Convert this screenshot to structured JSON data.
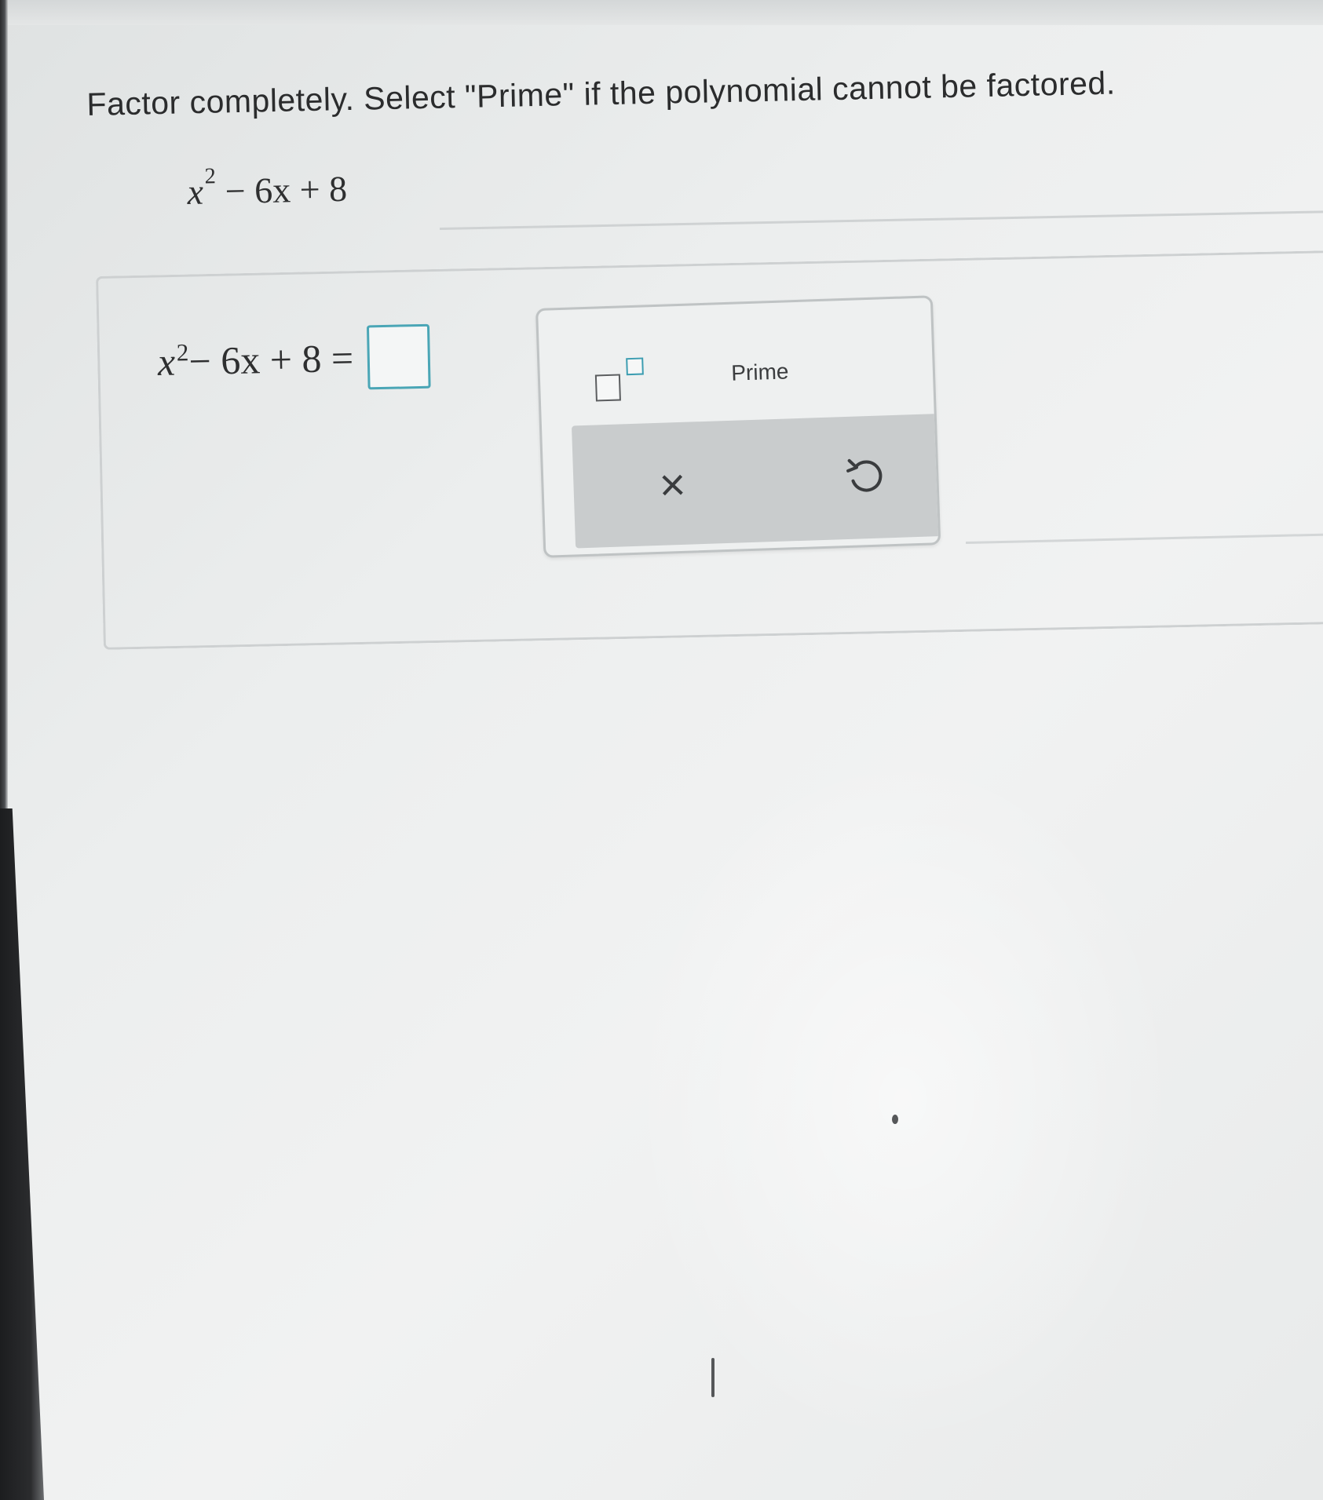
{
  "question": {
    "prompt": "Factor completely. Select \"Prime\" if the polynomial cannot be factored.",
    "expression": {
      "variable": "x",
      "exponent": "2",
      "rest": " − 6x + 8"
    }
  },
  "answer": {
    "lhs_variable": "x",
    "lhs_exponent": "2",
    "lhs_rest": " − 6x + 8 =",
    "value": ""
  },
  "keypad": {
    "prime_label": "Prime",
    "clear_symbol": "×",
    "icons": [
      "exponent-template-icon",
      "close-icon",
      "undo-icon"
    ]
  },
  "colors": {
    "accent": "#4aa6b6",
    "text": "#2b2c2d",
    "keypad_footer": "#c9cccd"
  }
}
